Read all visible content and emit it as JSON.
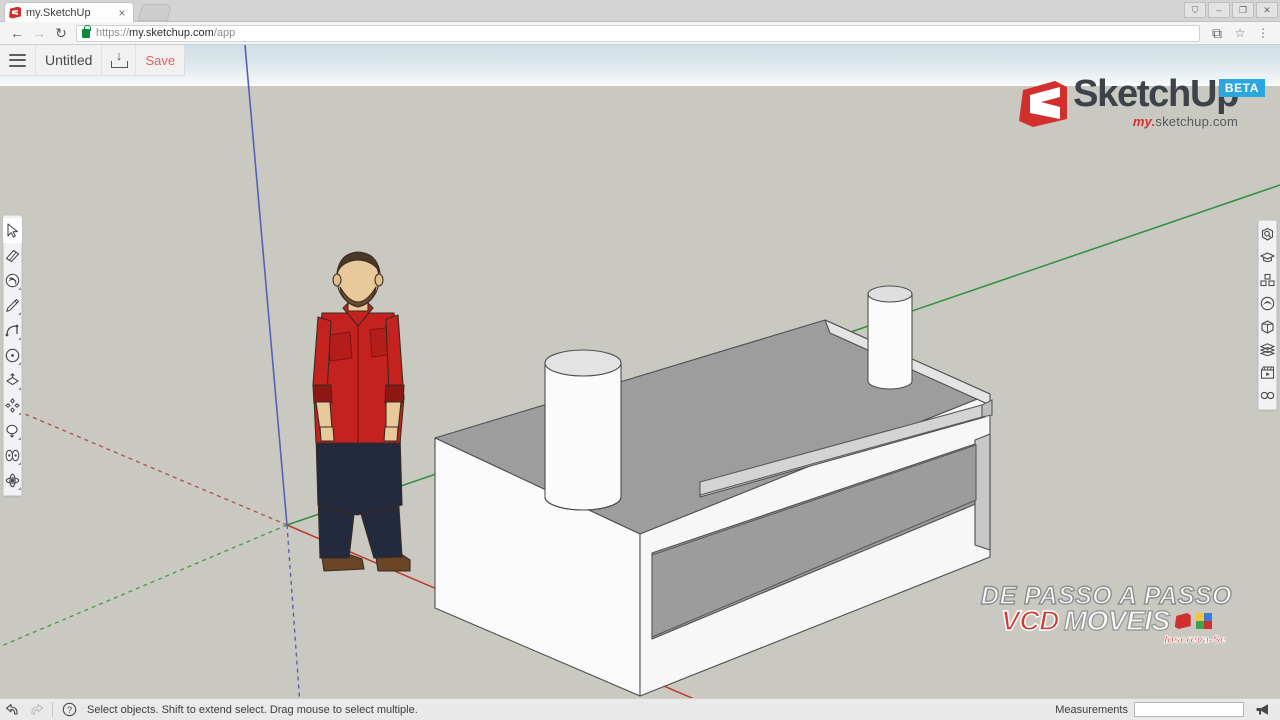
{
  "browser": {
    "tab": {
      "title": "my.SketchUp",
      "favicon": "sketchup-favicon",
      "close": "×"
    },
    "new_tab": "new-tab-button",
    "window_controls": [
      {
        "name": "profile-button",
        "glyph": "⛉"
      },
      {
        "name": "minimize-button",
        "glyph": "–"
      },
      {
        "name": "maximize-button",
        "glyph": "❐"
      },
      {
        "name": "close-button",
        "glyph": "✕"
      }
    ],
    "nav": {
      "back": "←",
      "forward": "→",
      "reload": "↻",
      "url_scheme": "https://",
      "url_host": "my.sketchup.com",
      "url_path": "/app",
      "extension_icon": "⧉",
      "bookmark_icon": "☆",
      "menu_icon": "⋮"
    }
  },
  "app_toolbar": {
    "menu_label": "main-menu",
    "document_title": "Untitled",
    "download_label": "download-icon",
    "save_label": "Save"
  },
  "logo": {
    "word_part1": "Sketch",
    "word_part2": "Up",
    "badge": "BETA",
    "sub_my": "my.",
    "sub_domain": "sketchup.com"
  },
  "left_toolbar": {
    "tools": [
      {
        "name": "select-tool",
        "label": "Select",
        "active": true,
        "flyout": false
      },
      {
        "name": "eraser-tool",
        "label": "Eraser",
        "active": false,
        "flyout": false
      },
      {
        "name": "paint-tool",
        "label": "Paint",
        "active": false,
        "flyout": true
      },
      {
        "name": "line-tool",
        "label": "Line",
        "active": false,
        "flyout": true
      },
      {
        "name": "arc-tool",
        "label": "Arc",
        "active": false,
        "flyout": true
      },
      {
        "name": "circle-tool",
        "label": "Circle",
        "active": false,
        "flyout": true
      },
      {
        "name": "pushpull-tool",
        "label": "Push/Pull",
        "active": false,
        "flyout": true
      },
      {
        "name": "move-tool",
        "label": "Move",
        "active": false,
        "flyout": true
      },
      {
        "name": "rotate-tool",
        "label": "Rotate",
        "active": false,
        "flyout": true
      },
      {
        "name": "tape-measure-tool",
        "label": "Tape Measure",
        "active": false,
        "flyout": true
      },
      {
        "name": "orbit-tool",
        "label": "Orbit",
        "active": false,
        "flyout": true
      }
    ]
  },
  "right_toolbar": {
    "panels": [
      {
        "name": "search-panel",
        "label": "Search"
      },
      {
        "name": "instructor-panel",
        "label": "Instructor"
      },
      {
        "name": "components-panel",
        "label": "Components"
      },
      {
        "name": "materials-panel",
        "label": "Materials"
      },
      {
        "name": "styles-panel",
        "label": "Styles"
      },
      {
        "name": "layers-panel",
        "label": "Layers"
      },
      {
        "name": "scenes-panel",
        "label": "Scenes"
      },
      {
        "name": "stereo-panel",
        "label": "3D View"
      }
    ]
  },
  "statusbar": {
    "undo_icon": "undo-arrow",
    "redo_icon": "redo-arrow",
    "help_icon": "?",
    "hint": "Select objects. Shift to extend select. Drag mouse to select multiple.",
    "measurements_label": "Measurements",
    "measurements_value": "",
    "measurements_placeholder": "",
    "feedback_icon": "megaphone-icon"
  },
  "watermark": {
    "line1": "DE PASSO A PASSO",
    "line2_red": "VCD",
    "line2_white": "MOVEIS",
    "line3": "Inscreva-Se"
  },
  "viewport": {
    "sky_color": "#dde7ec",
    "ground_color": "#c9c9c2",
    "axis_red": "#c0392b",
    "axis_green": "#2f8f3e",
    "axis_blue": "#5a5fb4",
    "model_face_light": "#f6f6f6",
    "model_face_mid": "#d6d6d6",
    "model_face_dark": "#9a9a9a",
    "model_face_inner": "#9d9d9d",
    "figure": {
      "shirt_color": "#c4221f",
      "shirt_dark": "#8e1714",
      "pants_color": "#232a3d",
      "skin_color": "#e8c99a",
      "hair_color": "#4a372a",
      "shoe_color": "#6b4526"
    }
  }
}
